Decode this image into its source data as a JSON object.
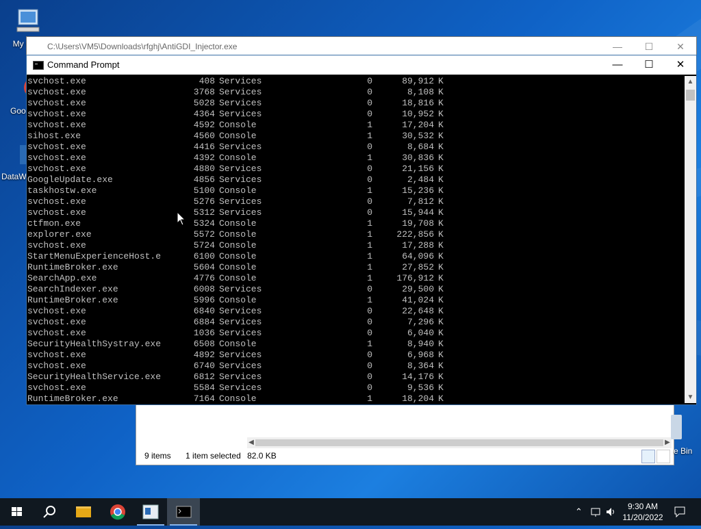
{
  "desktop": {
    "icons": [
      {
        "label": "My Co"
      },
      {
        "label": "Goo Chro"
      },
      {
        "label": "DataW"
      }
    ],
    "recycle_bin_label": "e Bin"
  },
  "explorer": {
    "status_items": "9 items",
    "status_selected": "1 item selected",
    "status_size": "82.0 KB"
  },
  "outer_window": {
    "title": "C:\\Users\\VM5\\Downloads\\rfghj\\AntiGDI_Injector.exe"
  },
  "cmd": {
    "title": "Command Prompt",
    "rows": [
      {
        "name": "svchost.exe",
        "pid": "408",
        "session": "Services",
        "num": "0",
        "mem": "89,912",
        "unit": "K"
      },
      {
        "name": "svchost.exe",
        "pid": "3768",
        "session": "Services",
        "num": "0",
        "mem": "8,108",
        "unit": "K"
      },
      {
        "name": "svchost.exe",
        "pid": "5028",
        "session": "Services",
        "num": "0",
        "mem": "18,816",
        "unit": "K"
      },
      {
        "name": "svchost.exe",
        "pid": "4364",
        "session": "Services",
        "num": "0",
        "mem": "10,952",
        "unit": "K"
      },
      {
        "name": "svchost.exe",
        "pid": "4592",
        "session": "Console",
        "num": "1",
        "mem": "17,204",
        "unit": "K"
      },
      {
        "name": "sihost.exe",
        "pid": "4560",
        "session": "Console",
        "num": "1",
        "mem": "30,532",
        "unit": "K"
      },
      {
        "name": "svchost.exe",
        "pid": "4416",
        "session": "Services",
        "num": "0",
        "mem": "8,684",
        "unit": "K"
      },
      {
        "name": "svchost.exe",
        "pid": "4392",
        "session": "Console",
        "num": "1",
        "mem": "30,836",
        "unit": "K"
      },
      {
        "name": "svchost.exe",
        "pid": "4880",
        "session": "Services",
        "num": "0",
        "mem": "21,156",
        "unit": "K"
      },
      {
        "name": "GoogleUpdate.exe",
        "pid": "4856",
        "session": "Services",
        "num": "0",
        "mem": "2,484",
        "unit": "K"
      },
      {
        "name": "taskhostw.exe",
        "pid": "5100",
        "session": "Console",
        "num": "1",
        "mem": "15,236",
        "unit": "K"
      },
      {
        "name": "svchost.exe",
        "pid": "5276",
        "session": "Services",
        "num": "0",
        "mem": "7,812",
        "unit": "K"
      },
      {
        "name": "svchost.exe",
        "pid": "5312",
        "session": "Services",
        "num": "0",
        "mem": "15,944",
        "unit": "K"
      },
      {
        "name": "ctfmon.exe",
        "pid": "5324",
        "session": "Console",
        "num": "1",
        "mem": "19,708",
        "unit": "K"
      },
      {
        "name": "explorer.exe",
        "pid": "5572",
        "session": "Console",
        "num": "1",
        "mem": "222,856",
        "unit": "K"
      },
      {
        "name": "svchost.exe",
        "pid": "5724",
        "session": "Console",
        "num": "1",
        "mem": "17,288",
        "unit": "K"
      },
      {
        "name": "StartMenuExperienceHost.e",
        "pid": "6100",
        "session": "Console",
        "num": "1",
        "mem": "64,096",
        "unit": "K"
      },
      {
        "name": "RuntimeBroker.exe",
        "pid": "5604",
        "session": "Console",
        "num": "1",
        "mem": "27,852",
        "unit": "K"
      },
      {
        "name": "SearchApp.exe",
        "pid": "4776",
        "session": "Console",
        "num": "1",
        "mem": "176,912",
        "unit": "K"
      },
      {
        "name": "SearchIndexer.exe",
        "pid": "6008",
        "session": "Services",
        "num": "0",
        "mem": "29,500",
        "unit": "K"
      },
      {
        "name": "RuntimeBroker.exe",
        "pid": "5996",
        "session": "Console",
        "num": "1",
        "mem": "41,024",
        "unit": "K"
      },
      {
        "name": "svchost.exe",
        "pid": "6840",
        "session": "Services",
        "num": "0",
        "mem": "22,648",
        "unit": "K"
      },
      {
        "name": "svchost.exe",
        "pid": "6884",
        "session": "Services",
        "num": "0",
        "mem": "7,296",
        "unit": "K"
      },
      {
        "name": "svchost.exe",
        "pid": "1036",
        "session": "Services",
        "num": "0",
        "mem": "6,040",
        "unit": "K"
      },
      {
        "name": "SecurityHealthSystray.exe",
        "pid": "6508",
        "session": "Console",
        "num": "1",
        "mem": "8,940",
        "unit": "K"
      },
      {
        "name": "svchost.exe",
        "pid": "4892",
        "session": "Services",
        "num": "0",
        "mem": "6,968",
        "unit": "K"
      },
      {
        "name": "svchost.exe",
        "pid": "6740",
        "session": "Services",
        "num": "0",
        "mem": "8,364",
        "unit": "K"
      },
      {
        "name": "SecurityHealthService.exe",
        "pid": "6812",
        "session": "Services",
        "num": "0",
        "mem": "14,176",
        "unit": "K"
      },
      {
        "name": "svchost.exe",
        "pid": "5584",
        "session": "Services",
        "num": "0",
        "mem": "9,536",
        "unit": "K"
      },
      {
        "name": "RuntimeBroker.exe",
        "pid": "7164",
        "session": "Console",
        "num": "1",
        "mem": "18,204",
        "unit": "K"
      }
    ]
  },
  "taskbar": {
    "buttons": [
      "start-icon",
      "search-icon",
      "file-explorer-icon",
      "chrome-icon",
      "app-icon",
      "cmd-icon"
    ],
    "time": "9:30 AM",
    "date": "11/20/2022",
    "accent": "#8ab4e8"
  }
}
